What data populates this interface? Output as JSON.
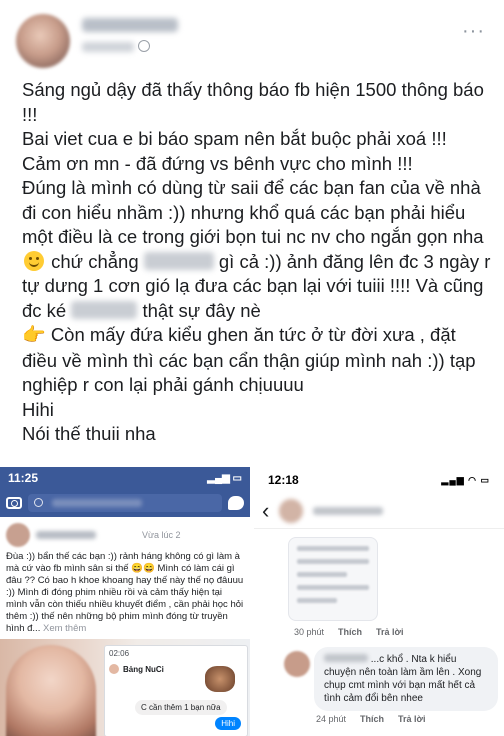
{
  "post": {
    "lines": [
      "Sáng ngủ dậy đã thấy thông báo fb hiện 1500 thông báo !!!",
      "Bai viet cua e bi báo spam nên bắt buộc phải xoá !!!",
      "Cảm ơn mn - đã đứng vs bênh vực cho mình !!!",
      "Đúng là mình có dùng từ saii để các bạn fan của về nhà đi con hiểu nhầm :)) nhưng khổ quá các bạn phải hiểu một điều là ce trong giới bọn tui nc nv cho ngắn gọn nha"
    ],
    "line5_a": "chứ chẳng",
    "line5_b": "gì cả :)) ảnh đăng lên đc 3 ngày r tự dưng 1 cơn gió lạ đưa các bạn lại với tuiii !!!! Và cũng đc ké",
    "line5_c": "thật sự đây nè",
    "line6": "Còn mấy đứa kiểu ghen ăn tức ở từ đời xưa , đặt điều về mình thì các bạn cẩn thận giúp mình nah :)) tạp nghiệp r con lại phải gánh chịuuuu",
    "line7": "Hihi",
    "line8": "Nói thế thuii nha",
    "icons": {
      "smile": "smile-emoji-icon",
      "pointer": "pointing-hand-icon",
      "globe": "globe-icon",
      "more": "more-icon"
    }
  },
  "left_shot": {
    "status_time": "11:25",
    "post_time": "Vừa lúc 2",
    "post_text": "Đùa :)) bẩn thế các bạn :)) rảnh háng không có gì làm à mà cứ vào fb mình sân si thế 😄😄 Mình có làm cái gì đâu ?? Có bao h khoe khoang hay thế này thế nọ đâuuu :)) Mình đi đóng phim nhiều rồi và cảm thấy hiện tại mình vẫn còn thiếu nhiều khuyết điểm , cần phải học hỏi thêm :)) thế nên những bộ phim mình đóng từ truyền hình đ...",
    "see_more": "Xem thêm",
    "chat": {
      "time": "02:06",
      "name": "Bảng NuCi",
      "bubble": "C cần thêm 1 bạn nữa",
      "reply": "Hihi"
    }
  },
  "right_shot": {
    "status_time": "12:18",
    "attach_time": "30 phút",
    "like": "Thích",
    "reply": "Trả lời",
    "comment_text": "...c khổ . Nta k hiểu chuyện nên toàn làm ầm lên . Xong chụp cmt mình với bạn mất hết cả tình cảm đổi bên nhee",
    "comment_time": "24 phút"
  }
}
